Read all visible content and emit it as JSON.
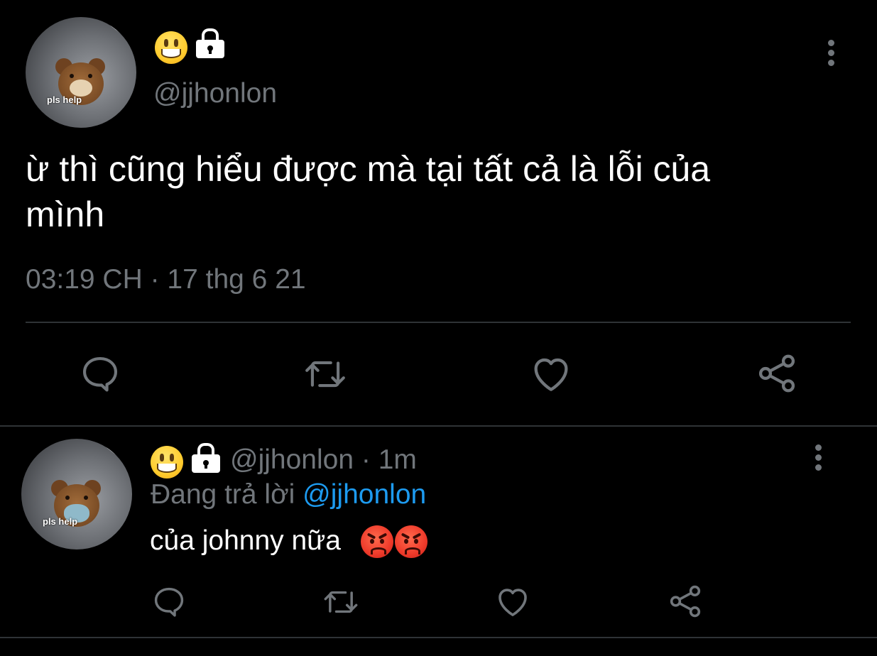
{
  "main_tweet": {
    "handle": "@jjhonlon",
    "avatar_caption": "pls help",
    "text": "ừ thì cũng hiểu được mà tại tất cả là lỗi của mình",
    "timestamp": "03:19 CH · 17 thg 6 21",
    "actions": [
      "reply-icon",
      "retweet-icon",
      "like-icon",
      "share-icon"
    ]
  },
  "reply_tweet": {
    "handle": "@jjhonlon",
    "time": "· 1m",
    "replying_prefix": "Đang trả lời",
    "replying_to": "@jjhonlon",
    "text": "của johnny nữa",
    "avatar_caption": "pls help",
    "actions": [
      "reply-icon",
      "retweet-icon",
      "like-icon",
      "share-icon"
    ]
  },
  "colors": {
    "background": "#000000",
    "text": "#e7e9ea",
    "muted": "#71767b",
    "link": "#1d9bf0",
    "divider": "#2f3336"
  }
}
